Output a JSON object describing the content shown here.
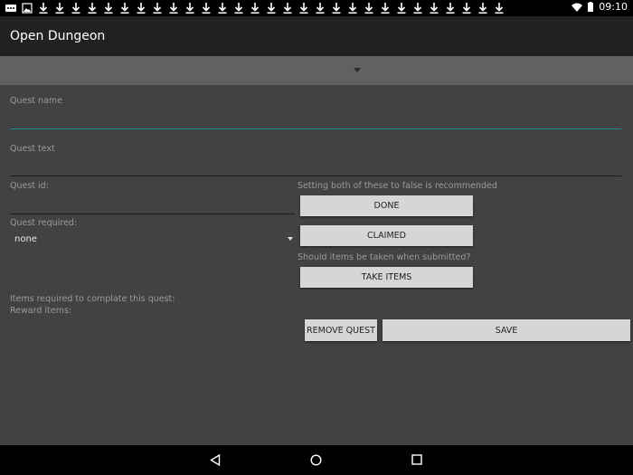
{
  "status_bar": {
    "time": "09:10",
    "icons_left": [
      "message-icon",
      "image-icon",
      "download-icon",
      "download-icon",
      "download-icon",
      "download-icon",
      "download-icon",
      "download-icon",
      "download-icon",
      "download-icon",
      "download-icon",
      "download-icon",
      "download-icon",
      "download-icon",
      "download-icon",
      "download-icon",
      "download-icon",
      "download-icon",
      "download-icon",
      "download-icon",
      "download-icon",
      "download-icon",
      "download-icon",
      "download-icon",
      "download-icon",
      "download-icon",
      "download-icon",
      "download-icon",
      "download-icon",
      "download-icon",
      "download-icon",
      "download-icon",
      "download-icon",
      "download-icon"
    ],
    "icons_right": [
      "wifi-icon",
      "battery-icon"
    ]
  },
  "app_bar": {
    "title": "Open Dungeon"
  },
  "form": {
    "quest_name_label": "Quest name",
    "quest_name_value": "",
    "quest_text_label": "Quest text",
    "quest_text_value": "",
    "quest_id_label": "Quest id:",
    "quest_id_value": "",
    "quest_required_label": "Quest required:",
    "quest_required_value": "none",
    "items_required_label": "Items required to complate this quest:",
    "reward_items_label": "Reward items:",
    "recommend_note": "Setting both of these to false is recommended",
    "take_items_question": "Should items be taken when submitted?"
  },
  "buttons": {
    "done": "DONE",
    "claimed": "CLAIMED",
    "take_items": "TAKE ITEMS",
    "remove_quest": "REMOVE QUEST",
    "save": "SAVE"
  },
  "colors": {
    "background": "#424242",
    "app_bar": "#212121",
    "spinner_bar": "#616161",
    "accent": "#1d8a8a",
    "button": "#d6d6d6"
  },
  "nav_bar": {
    "icons": [
      "back-icon",
      "home-icon",
      "recents-icon"
    ]
  }
}
